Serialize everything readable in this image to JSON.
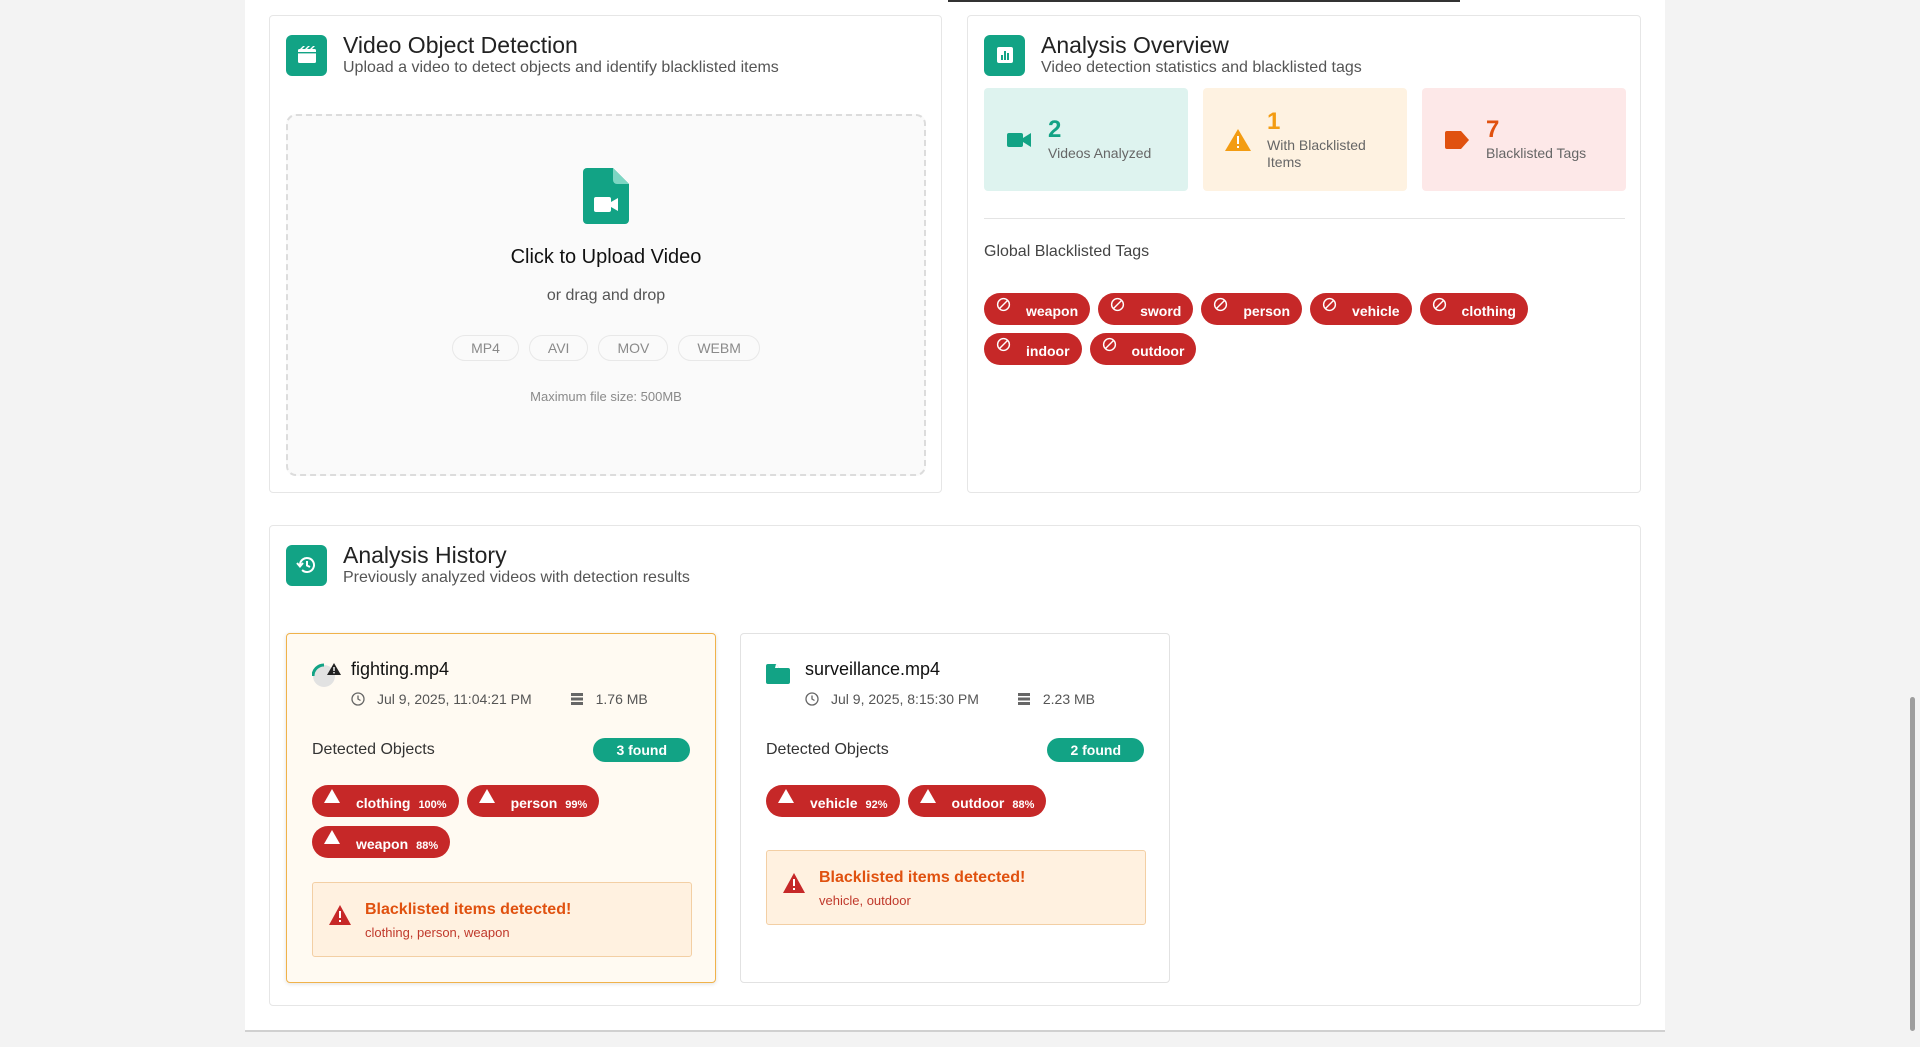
{
  "upload_card": {
    "title": "Video Object Detection",
    "subtitle": "Upload a video to detect objects and identify blacklisted items",
    "upload_title": "Click to Upload Video",
    "upload_or": "or drag and drop",
    "formats": [
      "MP4",
      "AVI",
      "MOV",
      "WEBM"
    ],
    "max_size": "Maximum file size: 500MB"
  },
  "overview": {
    "title": "Analysis Overview",
    "subtitle": "Video detection statistics and blacklisted tags",
    "stats": [
      {
        "value": "2",
        "label": "Videos Analyzed",
        "icon": "video-camera-icon",
        "color": "#12a385",
        "bg": "#def3ef"
      },
      {
        "value": "1",
        "label": "With Blacklisted Items",
        "icon": "warning-icon",
        "color": "#f39c12",
        "bg": "#fef2e1"
      },
      {
        "value": "7",
        "label": "Blacklisted Tags",
        "icon": "tag-icon",
        "color": "#e0510f",
        "bg": "#fde8e8"
      }
    ],
    "tags_label": "Global Blacklisted Tags",
    "tags": [
      "weapon",
      "sword",
      "person",
      "vehicle",
      "clothing",
      "indoor",
      "outdoor"
    ]
  },
  "history": {
    "title": "Analysis History",
    "subtitle": "Previously analyzed videos with detection results",
    "items": [
      {
        "name": "fighting.mp4",
        "date": "Jul 9, 2025, 11:04:21 PM",
        "size": "1.76 MB",
        "detected_label": "Detected Objects",
        "found": "3 found",
        "objects": [
          {
            "name": "clothing",
            "conf": "100%"
          },
          {
            "name": "person",
            "conf": "99%"
          },
          {
            "name": "weapon",
            "conf": "88%"
          }
        ],
        "alert_title": "Blacklisted items detected!",
        "alert_items": "clothing, person, weapon"
      },
      {
        "name": "surveillance.mp4",
        "date": "Jul 9, 2025, 8:15:30 PM",
        "size": "2.23 MB",
        "detected_label": "Detected Objects",
        "found": "2 found",
        "objects": [
          {
            "name": "vehicle",
            "conf": "92%"
          },
          {
            "name": "outdoor",
            "conf": "88%"
          }
        ],
        "alert_title": "Blacklisted items detected!",
        "alert_items": "vehicle, outdoor"
      }
    ]
  },
  "colors": {
    "accent": "#12a385",
    "danger": "#c62828",
    "warning": "#f0b24a"
  }
}
